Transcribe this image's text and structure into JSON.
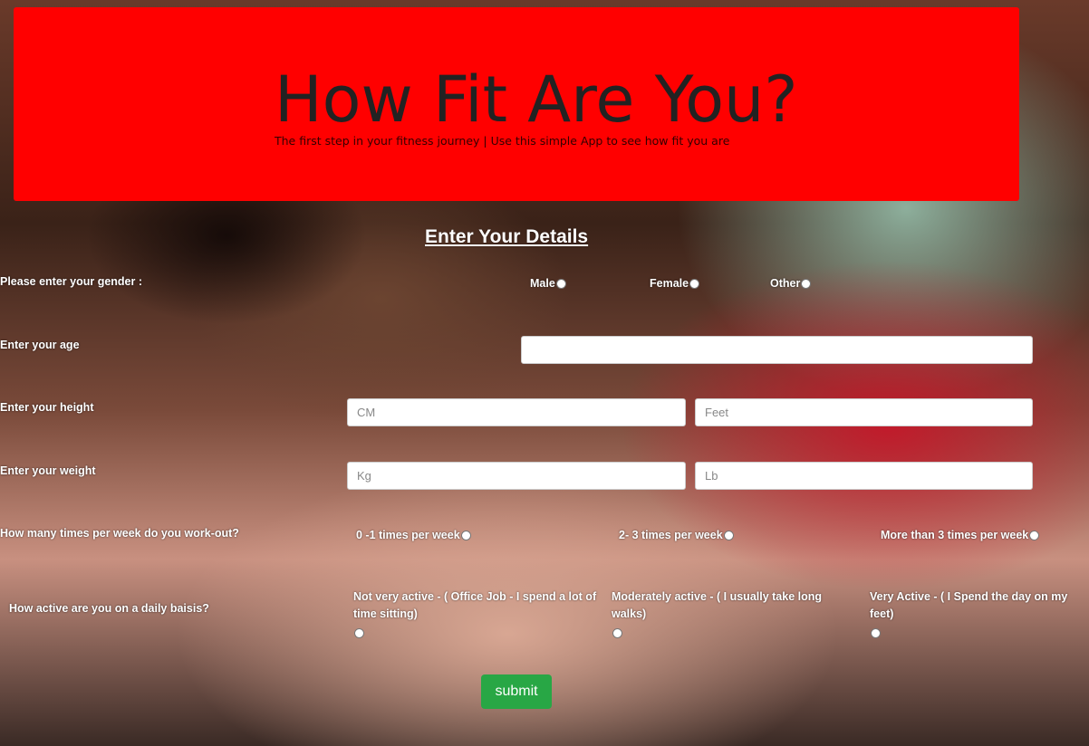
{
  "hero": {
    "title": "How Fit Are You?",
    "subtitle": "The first step in your fitness journey | Use this simple App to see how fit you are"
  },
  "form": {
    "section_title": "Enter Your Details",
    "gender": {
      "label": "Please enter your gender :",
      "options": [
        "Male",
        "Female",
        "Other"
      ]
    },
    "age": {
      "label": "Enter your age",
      "value": ""
    },
    "height": {
      "label": "Enter your height",
      "cm_placeholder": "CM",
      "feet_placeholder": "Feet"
    },
    "weight": {
      "label": "Enter your weight",
      "kg_placeholder": "Kg",
      "lb_placeholder": "Lb"
    },
    "workout": {
      "label": "How many times per week do you work-out?",
      "options": [
        "0 -1 times per week",
        "2- 3 times per week",
        "More than 3 times per week"
      ]
    },
    "activity": {
      "label": "How active are you on a daily baisis?",
      "options": [
        "Not very active - ( Office Job - I spend a lot of time sitting)",
        "Moderately active - ( I usually take long walks)",
        "Very Active - ( I Spend the day on my feet)"
      ]
    },
    "submit_label": "submit"
  },
  "colors": {
    "hero_bg": "#ff0000",
    "submit_bg": "#28a745"
  }
}
